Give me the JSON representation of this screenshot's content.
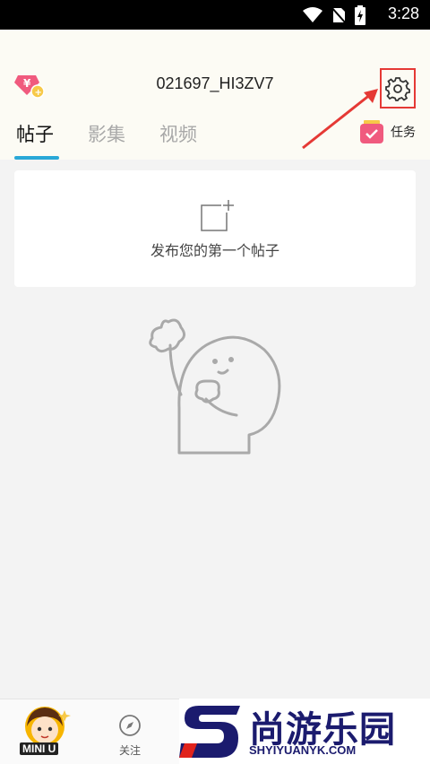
{
  "status_bar": {
    "time": "3:28"
  },
  "header": {
    "username": "021697_HI3ZV7"
  },
  "tabs": [
    {
      "label": "帖子",
      "active": true
    },
    {
      "label": "影集",
      "active": false
    },
    {
      "label": "视频",
      "active": false
    }
  ],
  "task": {
    "label": "任务"
  },
  "post_card": {
    "text": "发布您的第一个帖子"
  },
  "bottom_nav": {
    "logo_text": "MINI U",
    "follow_label": "关注"
  },
  "watermark": {
    "cn": "尚游乐园",
    "en": "SHYIYUANYK.COM"
  },
  "colors": {
    "accent": "#2aa8d7",
    "highlight": "#e53935"
  }
}
